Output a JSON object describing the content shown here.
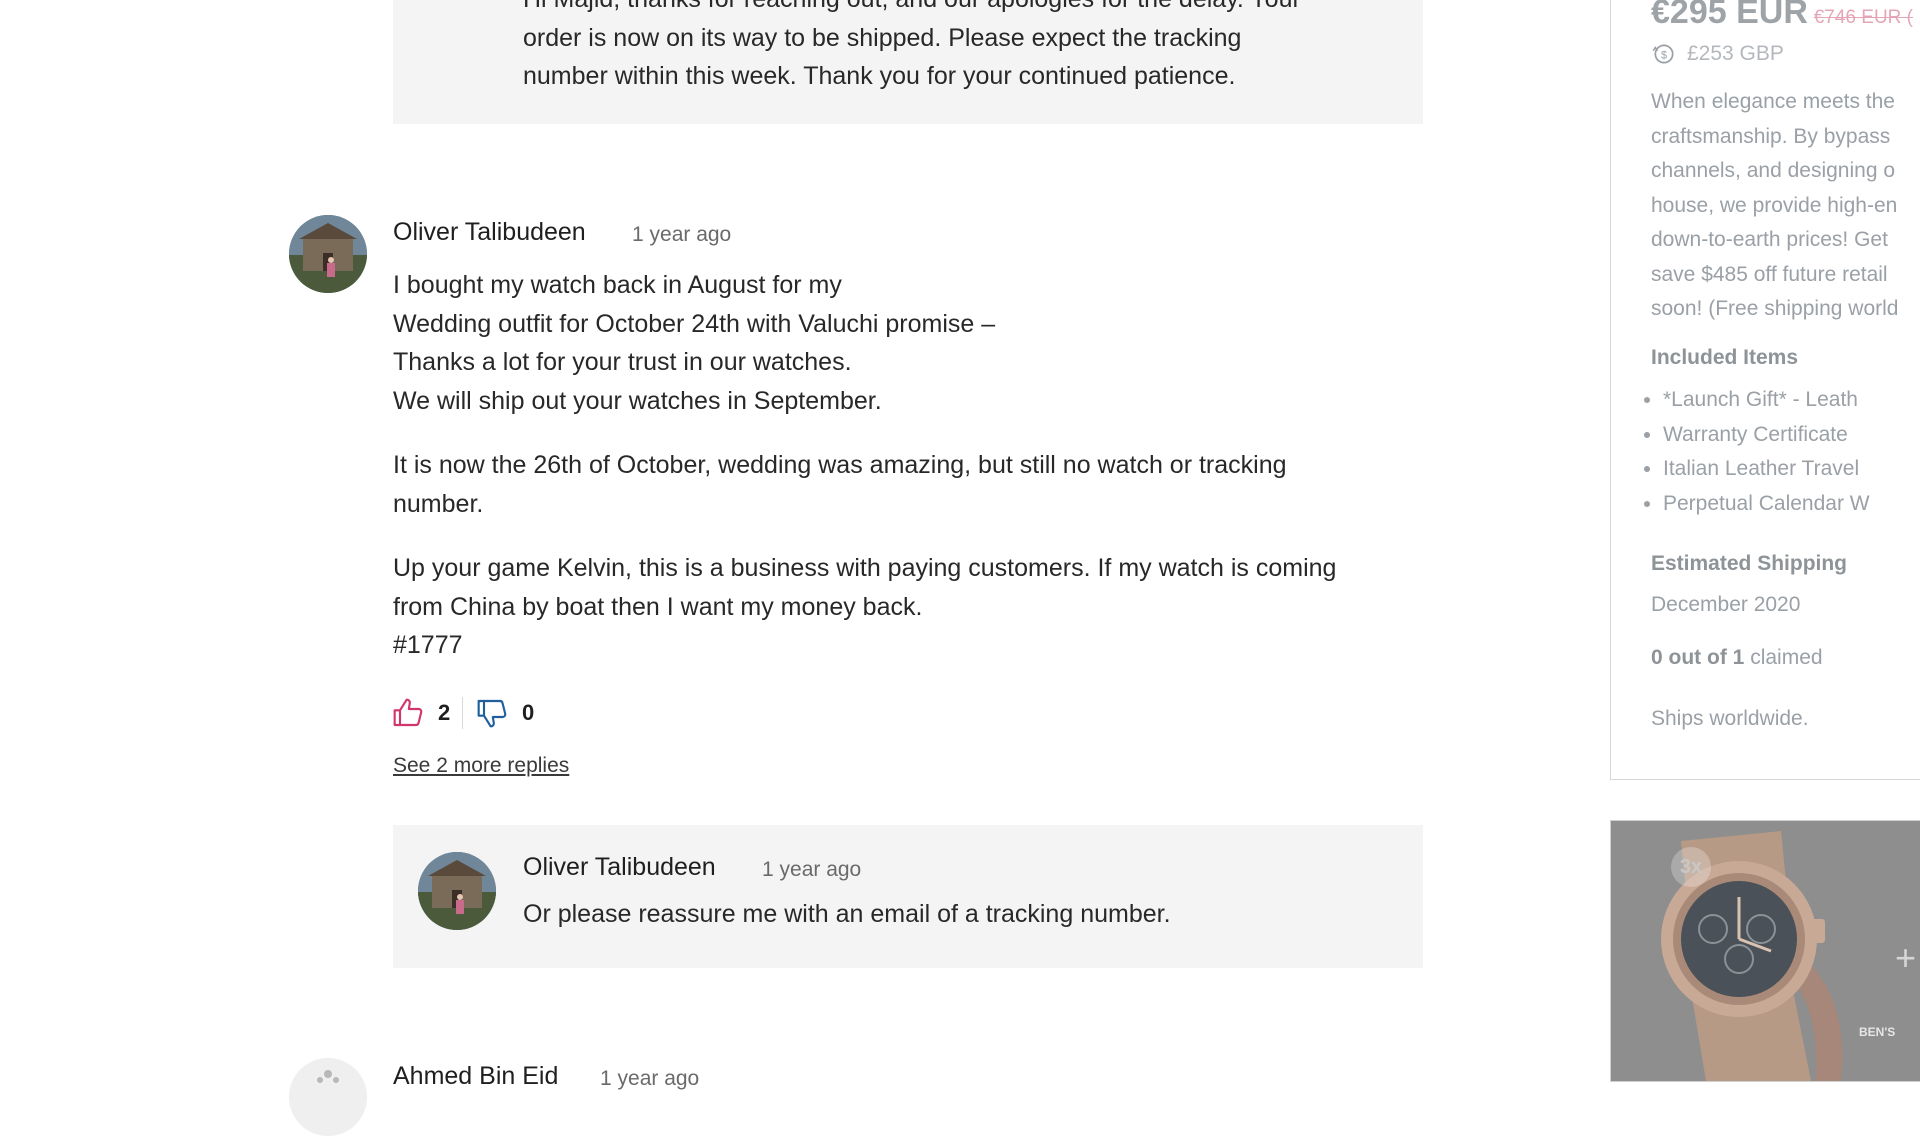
{
  "top_reply": {
    "lines": [
      "Hi Majid, thanks for reaching out, and our apologies for the delay. Your",
      "order is now on its way to be shipped. Please expect the tracking",
      "number within this week. Thank you for your continued patience."
    ]
  },
  "comment": {
    "author": "Oliver Talibudeen",
    "time": "1 year ago",
    "para1": [
      "I bought my watch back in August for my",
      "Wedding outfit for October 24th with Valuchi promise –",
      "Thanks a lot for your trust in our watches.",
      "We will ship out your watches in September."
    ],
    "para2": [
      "It is now the 26th of October, wedding was amazing, but still no watch or tracking",
      "number."
    ],
    "para3": [
      "Up your game Kelvin, this is a business with paying customers. If my watch is coming",
      "from China by boat then I want my money back.",
      "#1777"
    ],
    "likes": "2",
    "dislikes": "0",
    "see_more": "See 2 more replies",
    "reply": {
      "author": "Oliver Talibudeen",
      "time": "1 year ago",
      "text": "Or please reassure me with an email of a tracking number."
    }
  },
  "next_comment": {
    "author": "Ahmed Bin Eid",
    "time": "1 year ago"
  },
  "sidebar": {
    "price": "€295 EUR",
    "price_old": "€746 EUR (",
    "price_gbp": "£253 GBP",
    "description": [
      "When elegance meets the",
      "craftsmanship. By bypass",
      "channels, and designing o",
      "house, we provide high-en",
      "down-to-earth prices! Get",
      "save $485 off future retail",
      "soon! (Free shipping world"
    ],
    "included_title": "Included Items",
    "included_items": [
      "*Launch Gift* - Leath",
      "Warranty Certificate",
      "Italian Leather Travel",
      "Perpetual Calendar W"
    ],
    "shipping_title": "Estimated Shipping",
    "shipping_date": "December 2020",
    "claimed_count": "0 out of 1",
    "claimed_label": "claimed",
    "ships_worldwide": "Ships worldwide.",
    "image_badge": "3x",
    "image_plus": "+",
    "image_watermark": "BEN'S"
  }
}
